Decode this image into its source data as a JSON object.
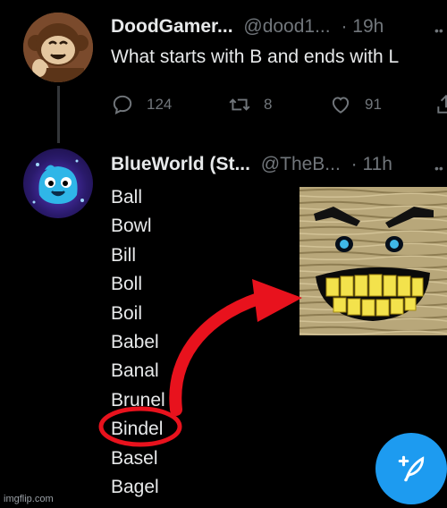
{
  "tweet1": {
    "display_name": "DoodGamer...",
    "handle": "@dood1...",
    "time": "· 19h",
    "text": "What starts with B and ends with L",
    "avatar_icon": "monkey-avatar-icon",
    "actions": {
      "replies": "124",
      "retweets": "8",
      "likes": "91"
    }
  },
  "tweet2": {
    "display_name": "BlueWorld (St...",
    "handle": "@TheB...",
    "time": "· 11h",
    "avatar_icon": "blue-blob-avatar-icon",
    "words": [
      "Ball",
      "Bowl",
      "Bill",
      "Boll",
      "Boil",
      "Babel",
      "Banal",
      "Brunel",
      "Bindel",
      "Basel",
      "Bagel"
    ],
    "highlighted_word": "Bindel"
  },
  "meme_image": "grinning-face-meme",
  "watermark": "imgflip.com",
  "fab_icon": "compose-tweet-icon",
  "colors": {
    "background": "#000000",
    "text": "#e7e9ea",
    "muted": "#71767b",
    "accent": "#1d9bf0",
    "annotation": "#e8121d"
  }
}
